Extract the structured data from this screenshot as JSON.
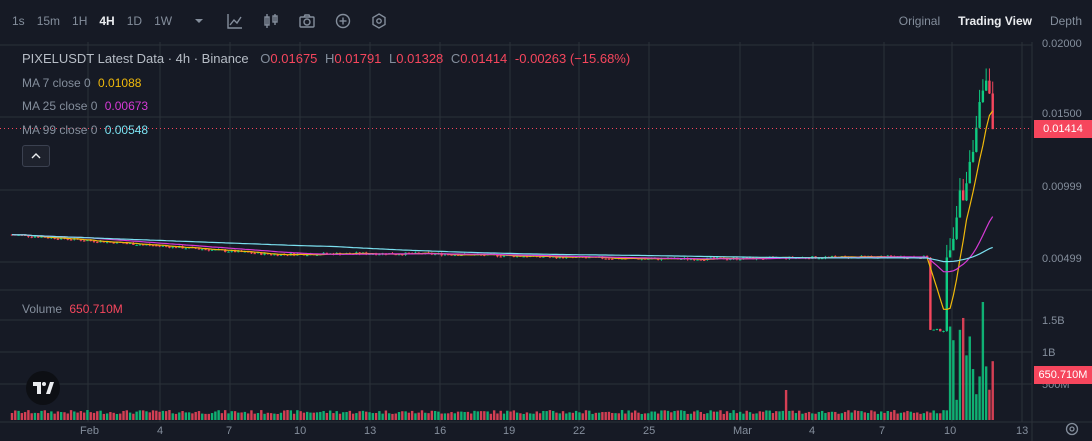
{
  "toolbar": {
    "timeframes": [
      "1s",
      "15m",
      "1H",
      "4H",
      "1D",
      "1W"
    ],
    "active_timeframe": "4H",
    "views": [
      "Original",
      "Trading View",
      "Depth"
    ],
    "active_view": "Trading View"
  },
  "legend": {
    "title": "PIXELUSDT Latest Data · 4h · Binance",
    "o_label": "O",
    "o": "0.01675",
    "h_label": "H",
    "h": "0.01791",
    "l_label": "L",
    "l": "0.01328",
    "c_label": "C",
    "c": "0.01414",
    "change": "-0.00263 (−15.68%)"
  },
  "ma": [
    {
      "label": "MA 7 close 0",
      "value": "0.01088",
      "color": "#f0b90b"
    },
    {
      "label": "MA 25 close 0",
      "value": "0.00673",
      "color": "#d63ad6"
    },
    {
      "label": "MA 99 close 0",
      "value": "0.00548",
      "color": "#7be0f0"
    }
  ],
  "volume": {
    "label": "Volume",
    "value": "650.710M"
  },
  "price_axis": [
    "0.02000",
    "0.01500",
    "0.00999",
    "0.00499"
  ],
  "current_price": "0.01414",
  "volume_axis": [
    "1.5B",
    "1B",
    "500M"
  ],
  "current_volume": "650.710M",
  "time_axis": [
    "Feb",
    "4",
    "7",
    "10",
    "13",
    "16",
    "19",
    "22",
    "25",
    "Mar",
    "4",
    "7",
    "10",
    "13"
  ],
  "colors": {
    "up": "#0ecb81",
    "down": "#f6465d",
    "bg": "#161a25",
    "grid": "#2b3139"
  },
  "icons": [
    "chevron-down-icon",
    "indicator-icon",
    "candle-type-icon",
    "camera-icon",
    "plus-circle-icon",
    "settings-hex-icon",
    "collapse-icon",
    "tradingview-logo",
    "settings-icon"
  ]
}
